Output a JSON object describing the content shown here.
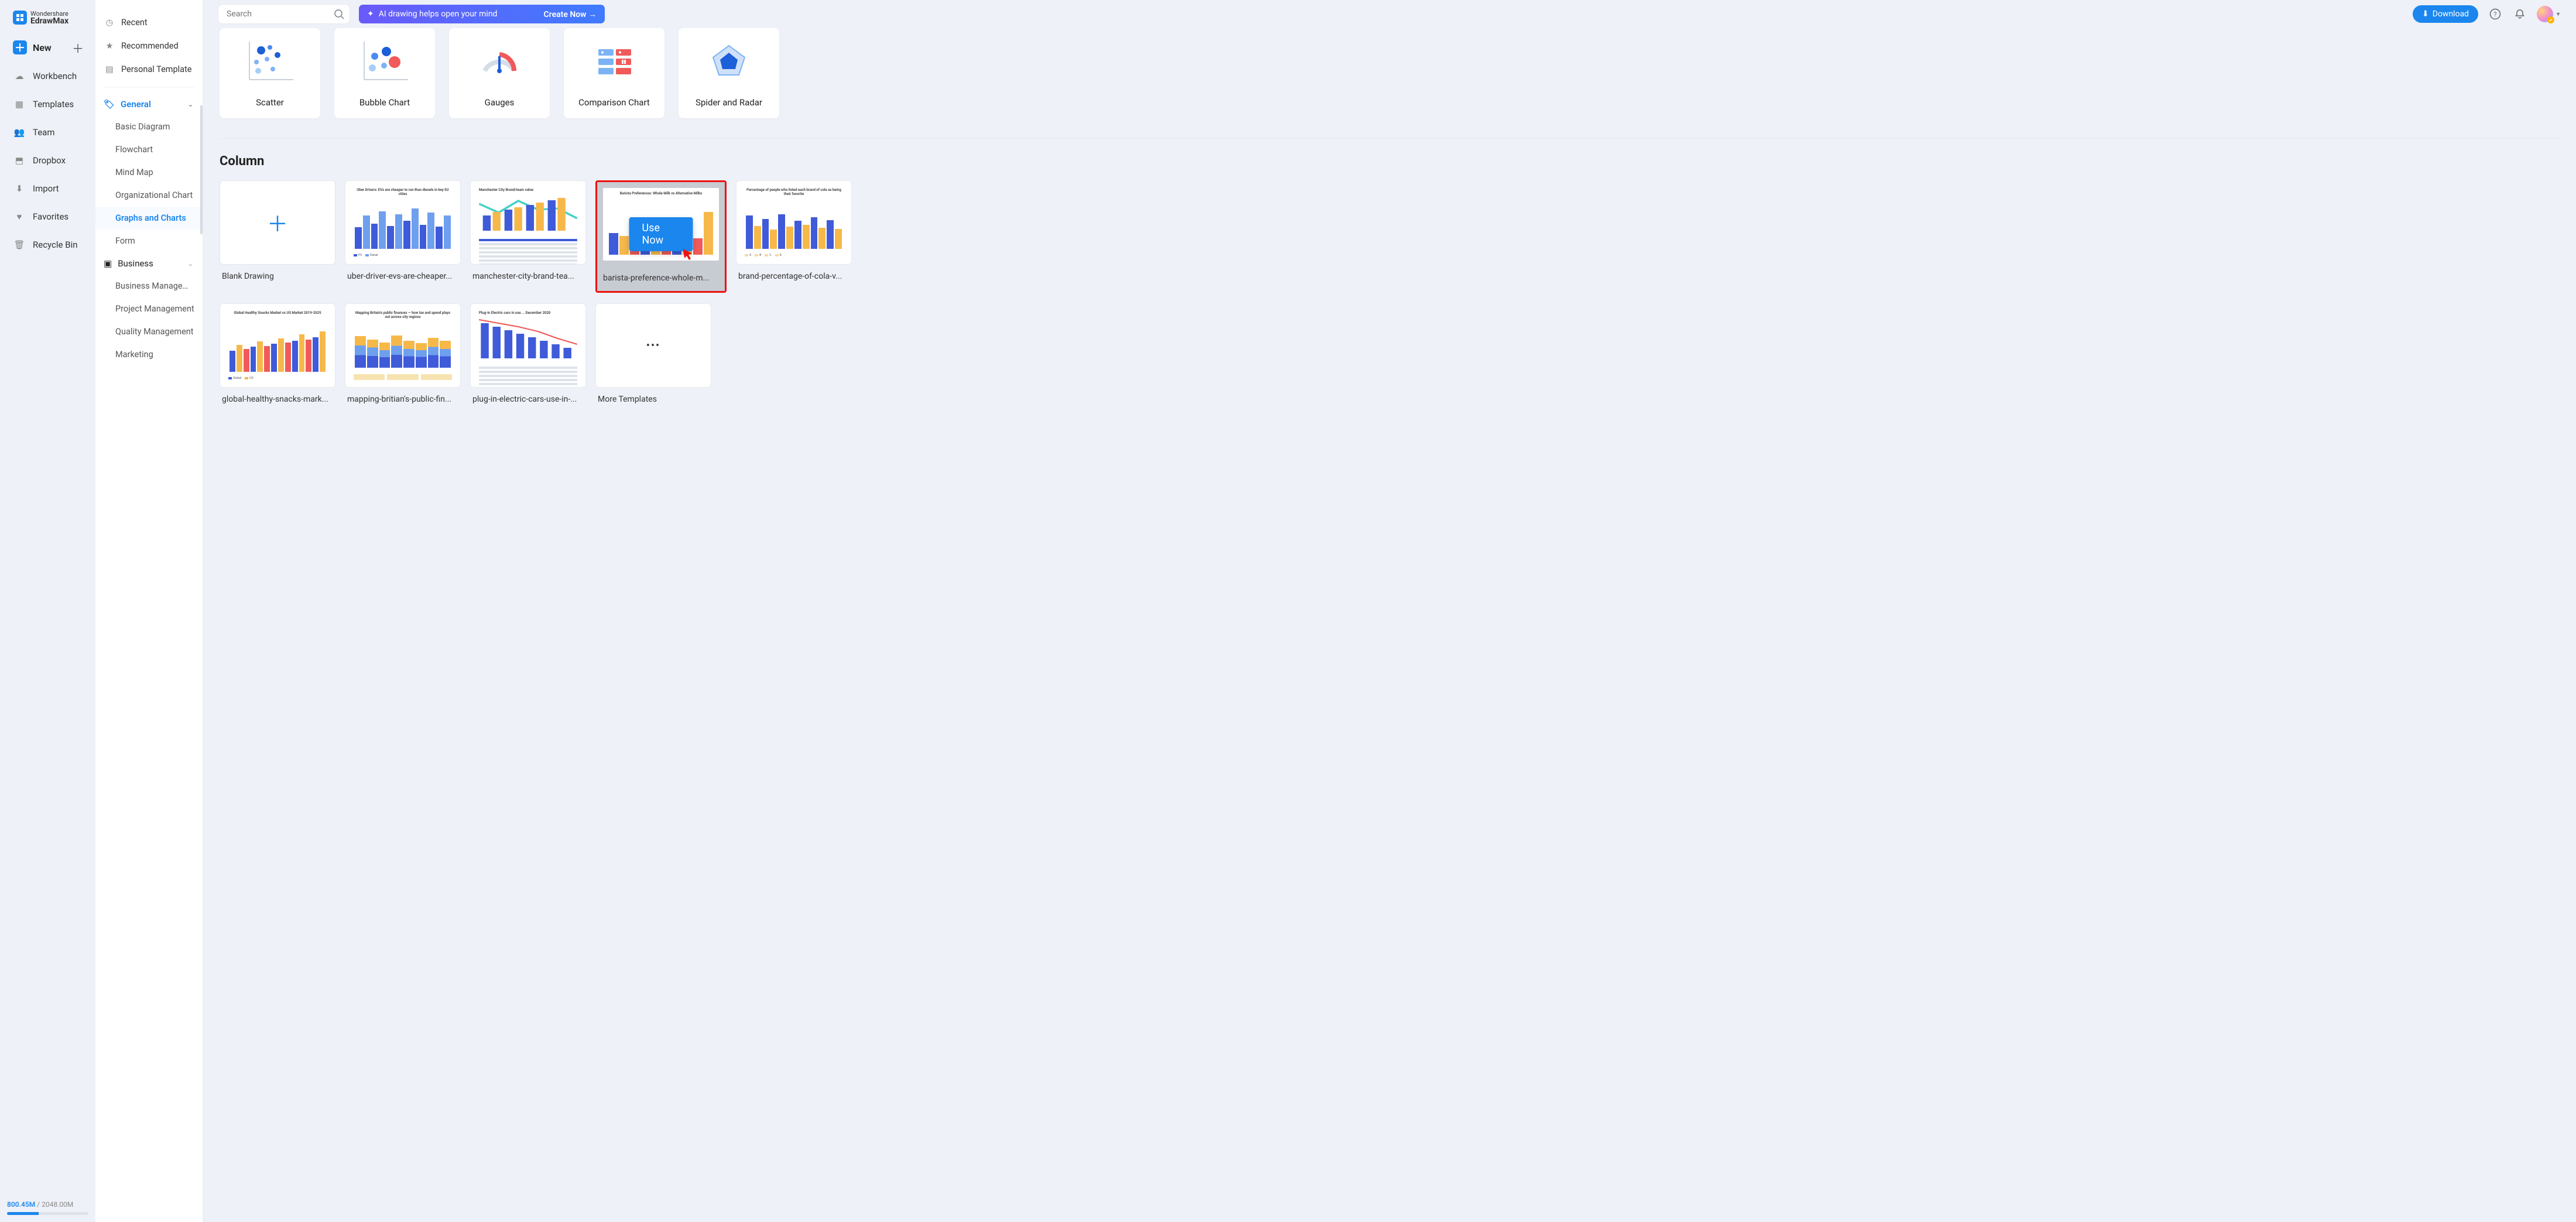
{
  "brand": {
    "top": "Wondershare",
    "name": "EdrawMax"
  },
  "nav1": {
    "new": "New",
    "items": [
      {
        "id": "workbench",
        "label": "Workbench"
      },
      {
        "id": "templates",
        "label": "Templates"
      },
      {
        "id": "team",
        "label": "Team"
      },
      {
        "id": "dropbox",
        "label": "Dropbox"
      },
      {
        "id": "import",
        "label": "Import"
      },
      {
        "id": "favorites",
        "label": "Favorites"
      },
      {
        "id": "recycle",
        "label": "Recycle Bin"
      }
    ]
  },
  "storage": {
    "used": "800.45M",
    "total": "2048.00M"
  },
  "nav2": {
    "top": [
      {
        "id": "recent",
        "label": "Recent"
      },
      {
        "id": "recommended",
        "label": "Recommended"
      },
      {
        "id": "personal",
        "label": "Personal Template"
      }
    ],
    "categories": [
      {
        "id": "general",
        "label": "General",
        "expanded": true,
        "active": true,
        "items": [
          {
            "label": "Basic Diagram"
          },
          {
            "label": "Flowchart"
          },
          {
            "label": "Mind Map"
          },
          {
            "label": "Organizational Chart"
          },
          {
            "label": "Graphs and Charts",
            "active": true
          },
          {
            "label": "Form"
          }
        ]
      },
      {
        "id": "business",
        "label": "Business",
        "expanded": true,
        "items": [
          {
            "label": "Business Management"
          },
          {
            "label": "Project Management"
          },
          {
            "label": "Quality Management"
          },
          {
            "label": "Marketing"
          }
        ]
      }
    ]
  },
  "topbar": {
    "search_placeholder": "Search",
    "ai_text": "AI drawing helps open your mind",
    "ai_cta": "Create Now",
    "download": "Download"
  },
  "category_cards": [
    {
      "id": "scatter",
      "label": "Scatter"
    },
    {
      "id": "bubble",
      "label": "Bubble Chart"
    },
    {
      "id": "gauges",
      "label": "Gauges"
    },
    {
      "id": "comparison",
      "label": "Comparison Chart"
    },
    {
      "id": "spider",
      "label": "Spider and Radar"
    }
  ],
  "section_title": "Column",
  "templates_row1": [
    {
      "id": "blank",
      "label": "Blank Drawing"
    },
    {
      "id": "uber",
      "label": "uber-driver-evs-are-cheaper..."
    },
    {
      "id": "mancity",
      "label": "manchester-city-brand-tea..."
    },
    {
      "id": "barista",
      "label": "barista-preference-whole-m...",
      "highlight": true,
      "use_now": "Use Now"
    },
    {
      "id": "cola",
      "label": "brand-percentage-of-cola-v..."
    }
  ],
  "templates_row2": [
    {
      "id": "snacks",
      "label": "global-healthy-snacks-mark..."
    },
    {
      "id": "britain",
      "label": "mapping-britian's-public-fin..."
    },
    {
      "id": "ev",
      "label": "plug-in-electric-cars-use-in-..."
    },
    {
      "id": "more",
      "label": "More Templates"
    }
  ]
}
